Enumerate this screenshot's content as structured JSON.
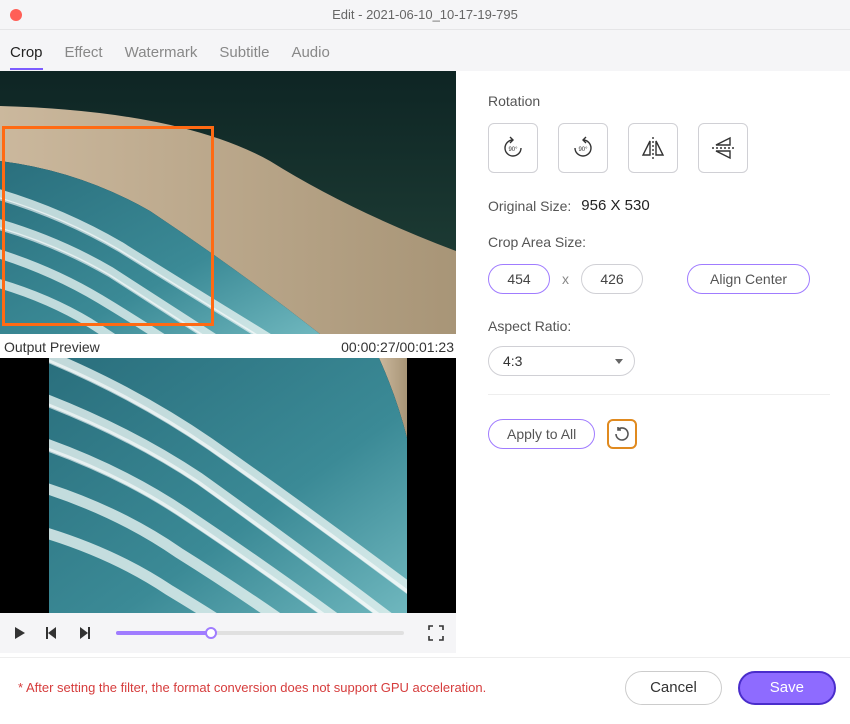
{
  "window": {
    "title": "Edit - 2021-06-10_10-17-19-795"
  },
  "tabs": {
    "items": [
      "Crop",
      "Effect",
      "Watermark",
      "Subtitle",
      "Audio"
    ],
    "active": 0
  },
  "preview": {
    "output_label": "Output Preview",
    "timecode": "00:00:27/00:01:23"
  },
  "rotation": {
    "label": "Rotation"
  },
  "original_size": {
    "label": "Original Size:",
    "value": "956 X 530"
  },
  "crop_area": {
    "label": "Crop Area Size:",
    "width": "454",
    "height": "426",
    "sep": "x",
    "align_btn": "Align Center"
  },
  "aspect": {
    "label": "Aspect Ratio:",
    "value": "4:3"
  },
  "apply": {
    "btn": "Apply to All"
  },
  "footer": {
    "note": "* After setting the filter, the format conversion does not support GPU acceleration.",
    "cancel": "Cancel",
    "save": "Save"
  }
}
